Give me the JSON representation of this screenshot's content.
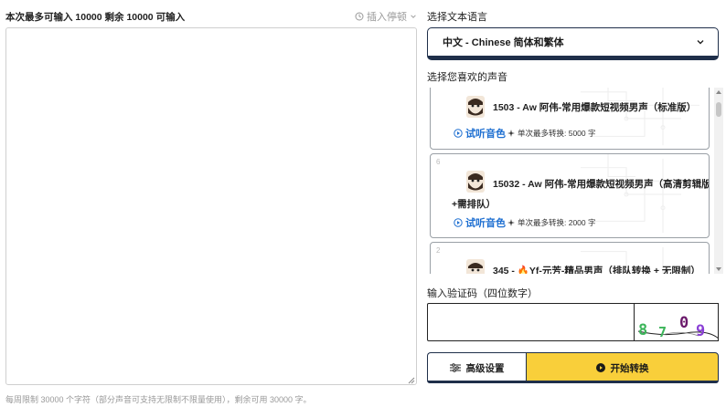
{
  "editor": {
    "limit_text": "本次最多可输入 10000 剩余 10000 可输入",
    "insert_pause_label": "插入停顿",
    "text_value": "",
    "footnote": "每周限制 30000 个字符（部分声音可支持无限制不限量使用），剩余可用 30000 字。"
  },
  "language": {
    "label": "选择文本语言",
    "selected": "中文 - Chinese 简体和繁体"
  },
  "voices": {
    "label": "选择您喜欢的声音",
    "items": [
      {
        "name": "1503 - Aw 阿伟-常用爆款短视频男声（标准版）",
        "listen_label": "试听音色",
        "quota": "单次最多转换: 5000 字"
      },
      {
        "index": "6",
        "name_line1": "15032 - Aw 阿伟-常用爆款短视频男声（高清剪辑版",
        "name_line2": "+需排队）",
        "listen_label": "试听音色",
        "quota": "单次最多转换: 2000 字"
      },
      {
        "index": "2",
        "name": "345 - 🔥Yf-元芳-精品男声（排队转换 + 无限制）"
      }
    ]
  },
  "captcha": {
    "label": "输入验证码（四位数字）",
    "input_value": "",
    "digits": [
      "8",
      "7",
      "0",
      "9"
    ],
    "digit_colors": [
      "#3cb55a",
      "#3cb55a",
      "#6b1a6b",
      "#8a3fd6"
    ]
  },
  "actions": {
    "advanced_label": "高级设置",
    "start_label": "开始转换"
  },
  "colors": {
    "accent_yellow": "#f9cf3a",
    "navy": "#1f2f4a",
    "link_blue": "#1e6fd1"
  }
}
